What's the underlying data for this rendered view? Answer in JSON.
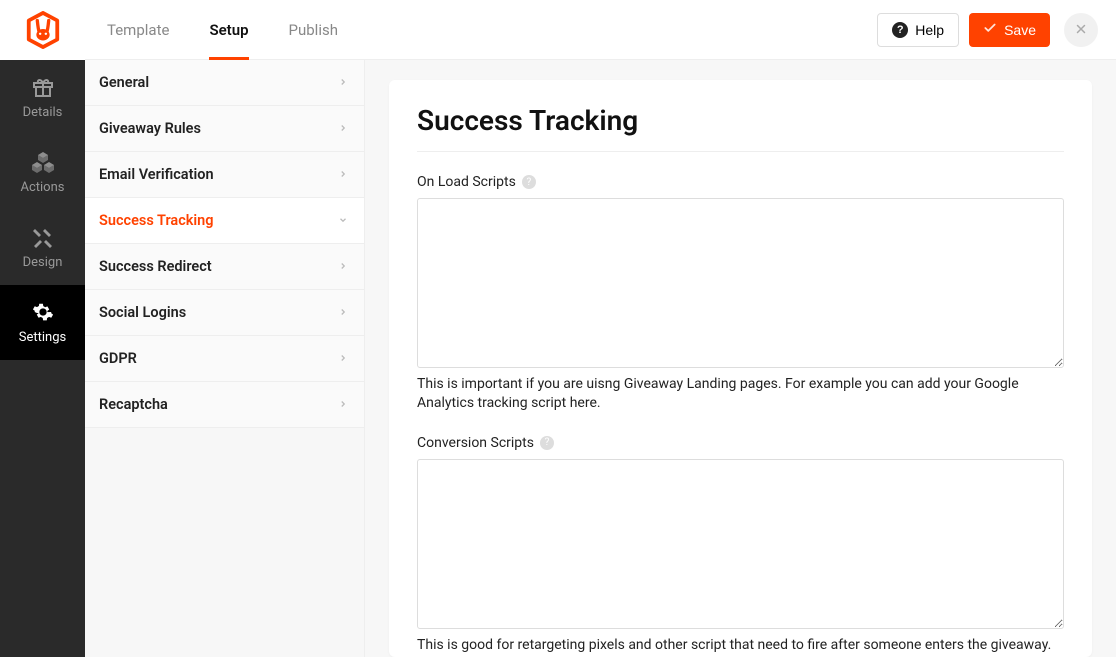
{
  "topTabs": {
    "template": "Template",
    "setup": "Setup",
    "publish": "Publish"
  },
  "topActions": {
    "help": "Help",
    "save": "Save"
  },
  "iconSidebar": {
    "details": "Details",
    "actions": "Actions",
    "design": "Design",
    "settings": "Settings"
  },
  "subSidebar": {
    "general": "General",
    "giveawayRules": "Giveaway Rules",
    "emailVerification": "Email Verification",
    "successTracking": "Success Tracking",
    "successRedirect": "Success Redirect",
    "socialLogins": "Social Logins",
    "gdpr": "GDPR",
    "recaptcha": "Recaptcha"
  },
  "panel": {
    "title": "Success Tracking",
    "onLoad": {
      "label": "On Load Scripts",
      "value": "",
      "help": "This is important if you are uisng Giveaway Landing pages. For example you can add your Google Analytics tracking script here."
    },
    "conversion": {
      "label": "Conversion Scripts",
      "value": "",
      "help": "This is good for retargeting pixels and other script that need to fire after someone enters the giveaway."
    }
  }
}
